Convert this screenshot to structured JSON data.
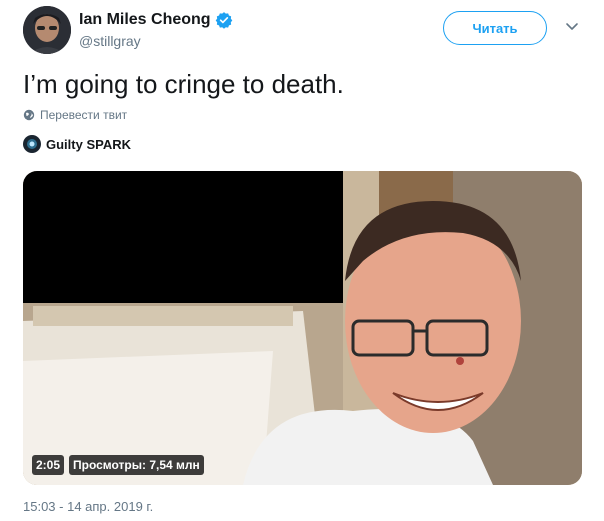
{
  "author": {
    "display_name": "Ian Miles Cheong",
    "handle": "@stillgray",
    "verified_icon": "verified-badge-icon"
  },
  "follow_button": {
    "label": "Читать"
  },
  "tweet": {
    "text": "I’m going to cringe to death.",
    "translate_label": "Перевести твит"
  },
  "embed_source": {
    "name": "Guilty SPARK"
  },
  "media": {
    "duration": "2:05",
    "views": "Просмотры: 7,54 млн"
  },
  "timestamp": "15:03 - 14 апр. 2019 г.",
  "colors": {
    "accent": "#1da1f2",
    "secondary_text": "#657786",
    "primary_text": "#14171a"
  }
}
